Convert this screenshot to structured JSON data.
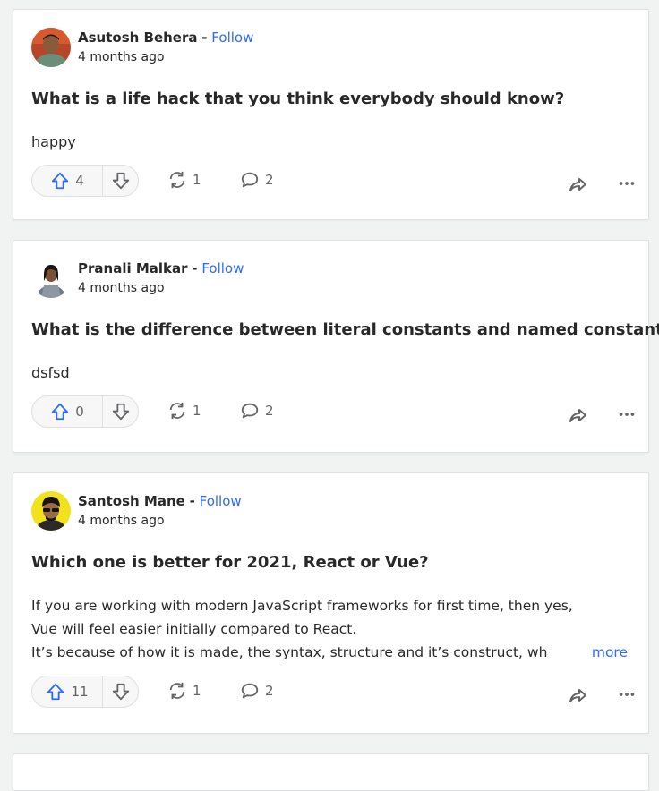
{
  "colors": {
    "accent": "#2e69ff",
    "text": "#282829",
    "muted": "#636466",
    "background": "#f1f2f2",
    "card": "#ffffff"
  },
  "posts": [
    {
      "author": "Asutosh Behera",
      "separator": "-",
      "follow_label": "Follow",
      "timestamp": "4 months ago",
      "question": "What is a life hack that you think everybody should know?",
      "body_lines": [
        "happy"
      ],
      "upvotes": "4",
      "shares": "1",
      "comments": "2",
      "icons": [
        "upvote-icon",
        "downvote-icon",
        "share-icon",
        "comment-icon",
        "forward-icon",
        "more-icon"
      ]
    },
    {
      "author": "Pranali Malkar",
      "separator": "-",
      "follow_label": "Follow",
      "timestamp": "4 months ago",
      "question": "What is the difference between literal constants and named constants?",
      "body_lines": [
        "dsfsd"
      ],
      "upvotes": "0",
      "shares": "1",
      "comments": "2",
      "icons": [
        "upvote-icon",
        "downvote-icon",
        "share-icon",
        "comment-icon",
        "forward-icon",
        "more-icon"
      ]
    },
    {
      "author": "Santosh Mane",
      "separator": "-",
      "follow_label": "Follow",
      "timestamp": "4 months ago",
      "question": "Which one is better for 2021, React or Vue?",
      "body_lines": [
        "If you are working with modern JavaScript frameworks for first time, then yes,",
        "Vue will feel easier initially compared to React.",
        "It’s because of how it is made, the syntax, structure and it’s construct, wh"
      ],
      "more_label": "more",
      "upvotes": "11",
      "shares": "1",
      "comments": "2",
      "icons": [
        "upvote-icon",
        "downvote-icon",
        "share-icon",
        "comment-icon",
        "forward-icon",
        "more-icon"
      ]
    }
  ]
}
